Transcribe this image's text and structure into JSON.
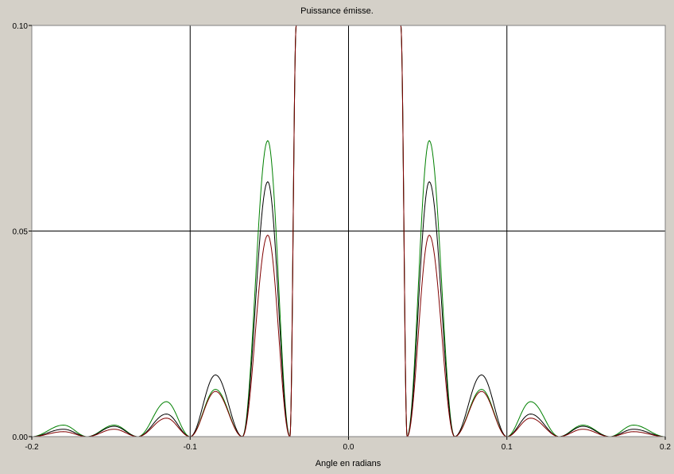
{
  "chart_data": {
    "type": "line",
    "title": "Puissance émisse.",
    "xlabel": "Angle en radians",
    "ylabel": "",
    "xlim": [
      -0.2,
      0.2
    ],
    "ylim": [
      0.0,
      0.1
    ],
    "grid": true,
    "x_ticks": [
      "-0.2",
      "-0.1",
      "0.0",
      "0.1",
      "0.2"
    ],
    "y_ticks": [
      "0.00",
      "0.05",
      "0.10"
    ],
    "x_tick_values": [
      -0.2,
      -0.1,
      0.0,
      0.1,
      0.2
    ],
    "y_tick_values": [
      0.0,
      0.05,
      0.1
    ],
    "background": "#ffffff",
    "frame_background": "#d4d0c8",
    "grid_color": "#000000",
    "x": [
      -0.2,
      -0.18,
      -0.165,
      -0.148,
      -0.133,
      -0.115,
      -0.1,
      -0.084,
      -0.067,
      -0.051,
      -0.037,
      -0.033,
      0.033,
      0.037,
      0.051,
      0.067,
      0.084,
      0.1,
      0.115,
      0.133,
      0.148,
      0.165,
      0.18,
      0.2
    ],
    "series": [
      {
        "color": "#008000",
        "values": [
          0.0,
          0.0028,
          0.0,
          0.0028,
          0.0,
          0.0085,
          0.0,
          0.0115,
          0.0,
          0.072,
          0.0,
          0.1,
          0.1,
          0.0,
          0.072,
          0.0,
          0.0115,
          0.0,
          0.0085,
          0.0,
          0.0028,
          0.0,
          0.0028,
          0.0
        ]
      },
      {
        "color": "#000000",
        "values": [
          0.0,
          0.0018,
          0.0,
          0.0025,
          0.0,
          0.0055,
          0.0,
          0.015,
          0.0,
          0.062,
          0.0,
          0.1,
          0.1,
          0.0,
          0.062,
          0.0,
          0.015,
          0.0,
          0.0055,
          0.0,
          0.0025,
          0.0,
          0.0018,
          0.0
        ]
      },
      {
        "color": "#800000",
        "values": [
          0.0,
          0.0012,
          0.0,
          0.0018,
          0.0,
          0.0045,
          0.0,
          0.011,
          0.0,
          0.049,
          0.0,
          0.1,
          0.1,
          0.0,
          0.049,
          0.0,
          0.011,
          0.0,
          0.0045,
          0.0,
          0.0018,
          0.0,
          0.0012,
          0.0
        ]
      }
    ]
  }
}
